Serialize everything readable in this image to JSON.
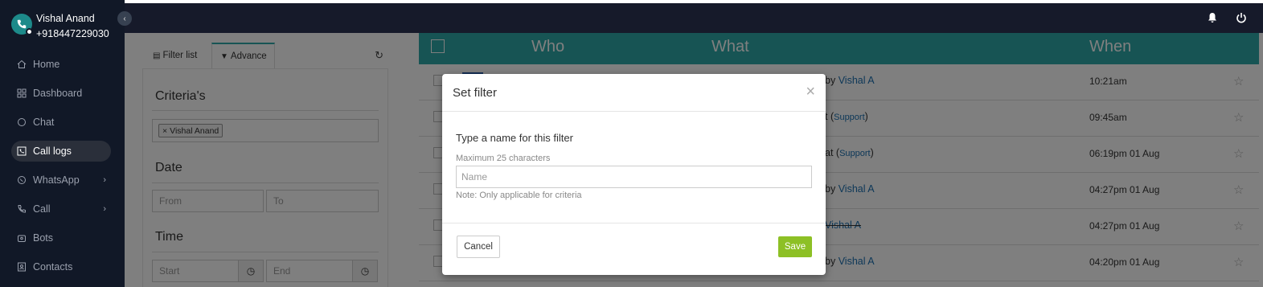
{
  "user": {
    "name": "Vishal Anand",
    "phone": "+918447229030"
  },
  "sidebar": {
    "items": [
      {
        "label": "Home",
        "icon": "home-icon"
      },
      {
        "label": "Dashboard",
        "icon": "dashboard-icon"
      },
      {
        "label": "Chat",
        "icon": "chat-icon"
      },
      {
        "label": "Call logs",
        "icon": "call-logs-icon",
        "active": true
      },
      {
        "label": "WhatsApp",
        "icon": "whatsapp-icon",
        "expandable": true
      },
      {
        "label": "Call",
        "icon": "phone-icon",
        "expandable": true
      },
      {
        "label": "Bots",
        "icon": "bot-icon"
      },
      {
        "label": "Contacts",
        "icon": "contacts-icon"
      }
    ]
  },
  "filter_panel": {
    "tabs": [
      {
        "label": "Filter list"
      },
      {
        "label": "Advance",
        "active": true
      }
    ],
    "criteria_title": "Criteria's",
    "criteria_tags": [
      "Vishal Anand"
    ],
    "date_title": "Date",
    "date_from_placeholder": "From",
    "date_to_placeholder": "To",
    "time_title": "Time",
    "time_start_placeholder": "Start",
    "time_end_placeholder": "End"
  },
  "table": {
    "headers": {
      "who": "Who",
      "what": "What",
      "when": "When"
    },
    "rows": [
      {
        "what_prefix": "by ",
        "what_link": "Vishal A",
        "what_suffix": "",
        "when": "10:21am"
      },
      {
        "what_prefix": "t (",
        "what_link": "Support",
        "what_suffix": ")",
        "when": "09:45am"
      },
      {
        "what_prefix": " at (",
        "what_link": "Support",
        "what_suffix": ")",
        "when": "06:19pm 01 Aug"
      },
      {
        "what_prefix": "by ",
        "what_link": "Vishal A",
        "what_suffix": "",
        "when": "04:27pm 01 Aug"
      },
      {
        "what_prefix": "",
        "what_link": "Vishal A",
        "what_suffix": "",
        "when": "04:27pm 01 Aug",
        "strike": true
      },
      {
        "what_prefix": "by ",
        "what_link": "Vishal A",
        "what_suffix": "",
        "when": "04:20pm 01 Aug"
      }
    ]
  },
  "modal": {
    "title": "Set filter",
    "label": "Type a name for this filter",
    "help": "Maximum 25 characters",
    "input_placeholder": "Name",
    "note": "Note: Only applicable for criteria",
    "cancel_label": "Cancel",
    "save_label": "Save"
  },
  "colors": {
    "accent": "#2fa8a8",
    "save": "#8dc025",
    "sidebar_bg": "#111827",
    "link": "#1a6fb0"
  }
}
